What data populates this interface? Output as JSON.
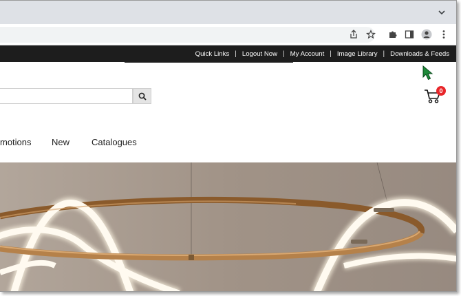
{
  "browser": {
    "icons": [
      "chevron-down-icon",
      "share-icon",
      "star-icon",
      "puzzle-icon",
      "sidepanel-icon",
      "profile-icon",
      "kebab-menu-icon"
    ]
  },
  "topbar": {
    "links": [
      "Quick Links",
      "Logout Now",
      "My Account",
      "Image Library",
      "Downloads & Feeds"
    ]
  },
  "header": {
    "search_placeholder": "",
    "cart_count": "0"
  },
  "nav": {
    "items": [
      "motions",
      "New",
      "Catalogues"
    ]
  },
  "colors": {
    "topbar_bg": "#1d1d1d",
    "cart_badge": "#e8262a",
    "cursor": "#1f8a3a",
    "hero_gold": "#b5814a"
  }
}
